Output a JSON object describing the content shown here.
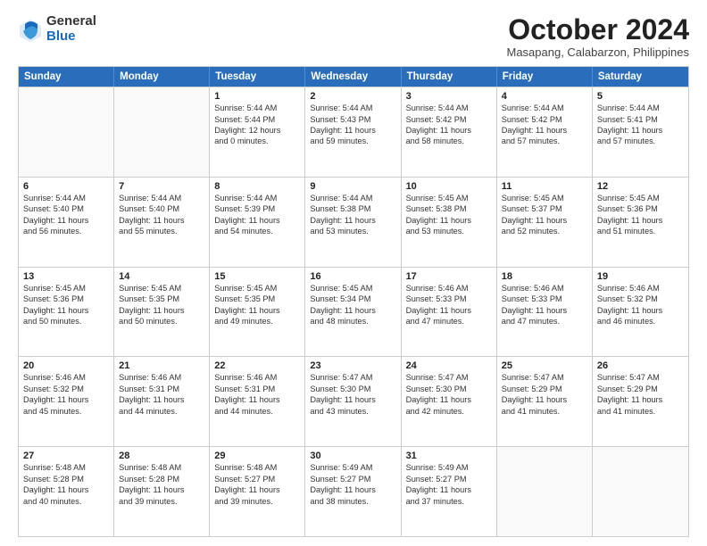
{
  "header": {
    "logo_general": "General",
    "logo_blue": "Blue",
    "month_title": "October 2024",
    "subtitle": "Masapang, Calabarzon, Philippines"
  },
  "calendar": {
    "days_of_week": [
      "Sunday",
      "Monday",
      "Tuesday",
      "Wednesday",
      "Thursday",
      "Friday",
      "Saturday"
    ],
    "rows": [
      [
        {
          "day": "",
          "lines": []
        },
        {
          "day": "",
          "lines": []
        },
        {
          "day": "1",
          "lines": [
            "Sunrise: 5:44 AM",
            "Sunset: 5:44 PM",
            "Daylight: 12 hours",
            "and 0 minutes."
          ]
        },
        {
          "day": "2",
          "lines": [
            "Sunrise: 5:44 AM",
            "Sunset: 5:43 PM",
            "Daylight: 11 hours",
            "and 59 minutes."
          ]
        },
        {
          "day": "3",
          "lines": [
            "Sunrise: 5:44 AM",
            "Sunset: 5:42 PM",
            "Daylight: 11 hours",
            "and 58 minutes."
          ]
        },
        {
          "day": "4",
          "lines": [
            "Sunrise: 5:44 AM",
            "Sunset: 5:42 PM",
            "Daylight: 11 hours",
            "and 57 minutes."
          ]
        },
        {
          "day": "5",
          "lines": [
            "Sunrise: 5:44 AM",
            "Sunset: 5:41 PM",
            "Daylight: 11 hours",
            "and 57 minutes."
          ]
        }
      ],
      [
        {
          "day": "6",
          "lines": [
            "Sunrise: 5:44 AM",
            "Sunset: 5:40 PM",
            "Daylight: 11 hours",
            "and 56 minutes."
          ]
        },
        {
          "day": "7",
          "lines": [
            "Sunrise: 5:44 AM",
            "Sunset: 5:40 PM",
            "Daylight: 11 hours",
            "and 55 minutes."
          ]
        },
        {
          "day": "8",
          "lines": [
            "Sunrise: 5:44 AM",
            "Sunset: 5:39 PM",
            "Daylight: 11 hours",
            "and 54 minutes."
          ]
        },
        {
          "day": "9",
          "lines": [
            "Sunrise: 5:44 AM",
            "Sunset: 5:38 PM",
            "Daylight: 11 hours",
            "and 53 minutes."
          ]
        },
        {
          "day": "10",
          "lines": [
            "Sunrise: 5:45 AM",
            "Sunset: 5:38 PM",
            "Daylight: 11 hours",
            "and 53 minutes."
          ]
        },
        {
          "day": "11",
          "lines": [
            "Sunrise: 5:45 AM",
            "Sunset: 5:37 PM",
            "Daylight: 11 hours",
            "and 52 minutes."
          ]
        },
        {
          "day": "12",
          "lines": [
            "Sunrise: 5:45 AM",
            "Sunset: 5:36 PM",
            "Daylight: 11 hours",
            "and 51 minutes."
          ]
        }
      ],
      [
        {
          "day": "13",
          "lines": [
            "Sunrise: 5:45 AM",
            "Sunset: 5:36 PM",
            "Daylight: 11 hours",
            "and 50 minutes."
          ]
        },
        {
          "day": "14",
          "lines": [
            "Sunrise: 5:45 AM",
            "Sunset: 5:35 PM",
            "Daylight: 11 hours",
            "and 50 minutes."
          ]
        },
        {
          "day": "15",
          "lines": [
            "Sunrise: 5:45 AM",
            "Sunset: 5:35 PM",
            "Daylight: 11 hours",
            "and 49 minutes."
          ]
        },
        {
          "day": "16",
          "lines": [
            "Sunrise: 5:45 AM",
            "Sunset: 5:34 PM",
            "Daylight: 11 hours",
            "and 48 minutes."
          ]
        },
        {
          "day": "17",
          "lines": [
            "Sunrise: 5:46 AM",
            "Sunset: 5:33 PM",
            "Daylight: 11 hours",
            "and 47 minutes."
          ]
        },
        {
          "day": "18",
          "lines": [
            "Sunrise: 5:46 AM",
            "Sunset: 5:33 PM",
            "Daylight: 11 hours",
            "and 47 minutes."
          ]
        },
        {
          "day": "19",
          "lines": [
            "Sunrise: 5:46 AM",
            "Sunset: 5:32 PM",
            "Daylight: 11 hours",
            "and 46 minutes."
          ]
        }
      ],
      [
        {
          "day": "20",
          "lines": [
            "Sunrise: 5:46 AM",
            "Sunset: 5:32 PM",
            "Daylight: 11 hours",
            "and 45 minutes."
          ]
        },
        {
          "day": "21",
          "lines": [
            "Sunrise: 5:46 AM",
            "Sunset: 5:31 PM",
            "Daylight: 11 hours",
            "and 44 minutes."
          ]
        },
        {
          "day": "22",
          "lines": [
            "Sunrise: 5:46 AM",
            "Sunset: 5:31 PM",
            "Daylight: 11 hours",
            "and 44 minutes."
          ]
        },
        {
          "day": "23",
          "lines": [
            "Sunrise: 5:47 AM",
            "Sunset: 5:30 PM",
            "Daylight: 11 hours",
            "and 43 minutes."
          ]
        },
        {
          "day": "24",
          "lines": [
            "Sunrise: 5:47 AM",
            "Sunset: 5:30 PM",
            "Daylight: 11 hours",
            "and 42 minutes."
          ]
        },
        {
          "day": "25",
          "lines": [
            "Sunrise: 5:47 AM",
            "Sunset: 5:29 PM",
            "Daylight: 11 hours",
            "and 41 minutes."
          ]
        },
        {
          "day": "26",
          "lines": [
            "Sunrise: 5:47 AM",
            "Sunset: 5:29 PM",
            "Daylight: 11 hours",
            "and 41 minutes."
          ]
        }
      ],
      [
        {
          "day": "27",
          "lines": [
            "Sunrise: 5:48 AM",
            "Sunset: 5:28 PM",
            "Daylight: 11 hours",
            "and 40 minutes."
          ]
        },
        {
          "day": "28",
          "lines": [
            "Sunrise: 5:48 AM",
            "Sunset: 5:28 PM",
            "Daylight: 11 hours",
            "and 39 minutes."
          ]
        },
        {
          "day": "29",
          "lines": [
            "Sunrise: 5:48 AM",
            "Sunset: 5:27 PM",
            "Daylight: 11 hours",
            "and 39 minutes."
          ]
        },
        {
          "day": "30",
          "lines": [
            "Sunrise: 5:49 AM",
            "Sunset: 5:27 PM",
            "Daylight: 11 hours",
            "and 38 minutes."
          ]
        },
        {
          "day": "31",
          "lines": [
            "Sunrise: 5:49 AM",
            "Sunset: 5:27 PM",
            "Daylight: 11 hours",
            "and 37 minutes."
          ]
        },
        {
          "day": "",
          "lines": []
        },
        {
          "day": "",
          "lines": []
        }
      ]
    ]
  }
}
